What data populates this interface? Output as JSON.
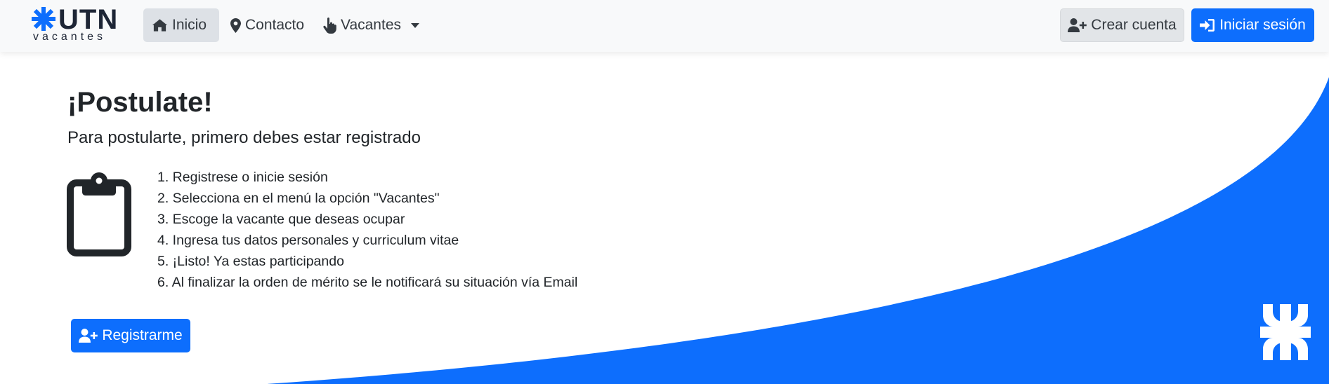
{
  "navbar": {
    "brand": {
      "main": "UTN",
      "sub": "vacantes"
    },
    "links": [
      {
        "label": "Inicio",
        "icon": "home-icon",
        "active": true
      },
      {
        "label": "Contacto",
        "icon": "map-marker-icon"
      },
      {
        "label": "Vacantes",
        "icon": "hand-pointer-icon",
        "dropdown": true
      }
    ],
    "create_account": {
      "label": "Crear cuenta",
      "icon": "user-plus-icon"
    },
    "login": {
      "label": "Iniciar sesión",
      "icon": "sign-in-icon"
    }
  },
  "main": {
    "title": "¡Postulate!",
    "subtitle": "Para postularte, primero debes estar registrado",
    "icon": "clipboard-icon",
    "steps": [
      "1. Registrese o inicie sesión",
      "2. Selecciona en el menú la opción \"Vacantes\"",
      "3. Escoge la vacante que deseas ocupar",
      "4. Ingresa tus datos personales y curriculum vitae",
      "5. ¡Listo! Ya estas participando",
      "6. Al finalizar la orden de mérito se le notificará su situación vía Email"
    ],
    "register_button": {
      "label": "Registrarme",
      "icon": "user-plus-icon"
    }
  },
  "colors": {
    "primary": "#0d6efd",
    "navbar_bg": "#f8f9fa",
    "text": "#212529",
    "brand": "#1d2535"
  }
}
